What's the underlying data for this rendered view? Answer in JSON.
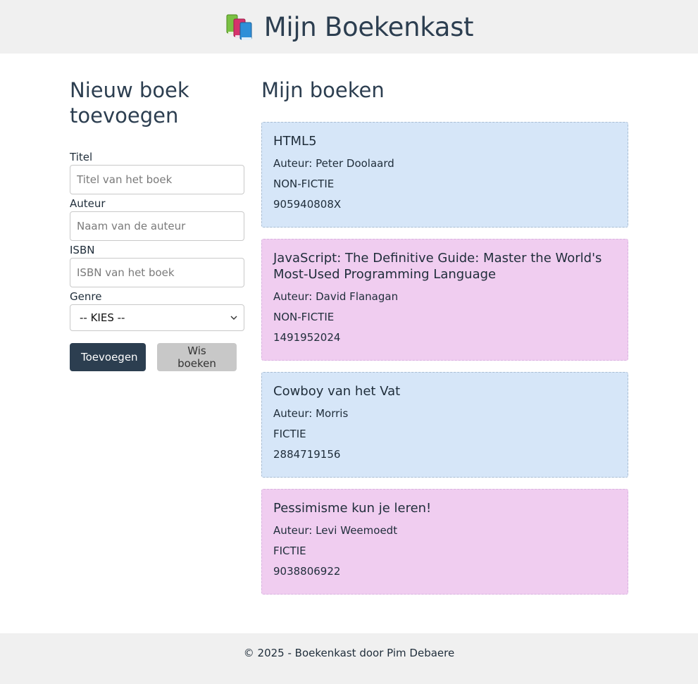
{
  "header": {
    "title": "Mijn Boekenkast",
    "logo_icon": "books-icon"
  },
  "form": {
    "heading": "Nieuw boek toevoegen",
    "title_label": "Titel",
    "title_placeholder": "Titel van het boek",
    "author_label": "Auteur",
    "author_placeholder": "Naam van de auteur",
    "isbn_label": "ISBN",
    "isbn_placeholder": "ISBN van het boek",
    "genre_label": "Genre",
    "genre_selected": "-- KIES --",
    "add_button": "Toevoegen",
    "clear_button": "Wis boeken"
  },
  "books_panel": {
    "heading": "Mijn boeken",
    "books": [
      {
        "title": "HTML5",
        "author": "Auteur: Peter Doolaard",
        "genre": "NON-FICTIE",
        "isbn": "905940808X",
        "color": "#d6e6f8"
      },
      {
        "title": "JavaScript: The Definitive Guide: Master the World's Most-Used Programming Language",
        "author": "Auteur: David Flanagan",
        "genre": "NON-FICTIE",
        "isbn": "1491952024",
        "color": "#f0cdf0"
      },
      {
        "title": "Cowboy van het Vat",
        "author": "Auteur: Morris",
        "genre": "FICTIE",
        "isbn": "2884719156",
        "color": "#d6e6f8"
      },
      {
        "title": "Pessimisme kun je leren!",
        "author": "Auteur: Levi Weemoedt",
        "genre": "FICTIE",
        "isbn": "9038806922",
        "color": "#f0cdf0"
      }
    ]
  },
  "footer": {
    "text": "© 2025 - Boekenkast door Pim Debaere"
  },
  "colors": {
    "primary": "#2c3e50",
    "header_bg": "#f0f0f0",
    "card_blue": "#d6e6f8",
    "card_pink": "#f0cdf0"
  }
}
